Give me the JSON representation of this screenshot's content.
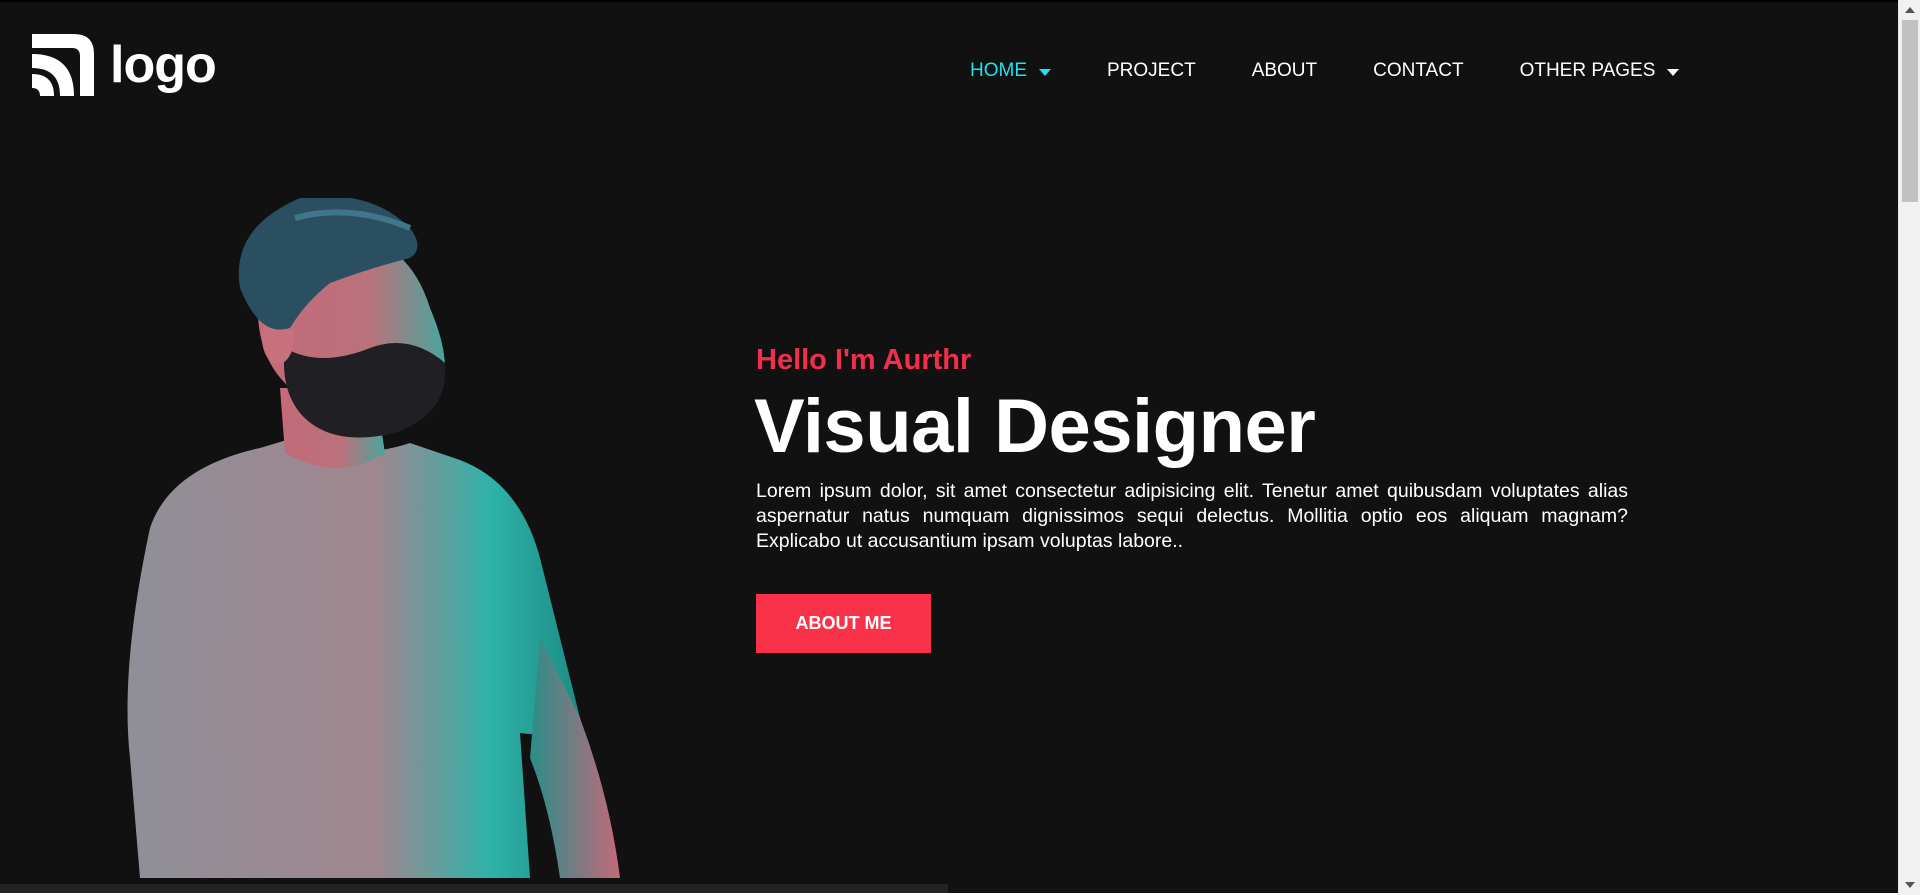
{
  "header": {
    "logo_text": "logo",
    "nav": [
      {
        "label": "HOME",
        "has_dropdown": true,
        "active": true
      },
      {
        "label": "PROJECT",
        "has_dropdown": false,
        "active": false
      },
      {
        "label": "ABOUT",
        "has_dropdown": false,
        "active": false
      },
      {
        "label": "CONTACT",
        "has_dropdown": false,
        "active": false
      },
      {
        "label": "OTHER PAGES",
        "has_dropdown": true,
        "active": false
      }
    ]
  },
  "hero": {
    "greeting": "Hello I'm Aurthr",
    "headline": "Visual Designer",
    "description": "Lorem ipsum dolor, sit amet consectetur adipisicing elit. Tenetur amet quibusdam voluptates alias aspernatur natus numquam dignissimos sequi delectus. Mollitia optio eos aliquam magnam? Explicabo ut accusantium ipsam voluptas labore..",
    "cta_label": "ABOUT ME",
    "figure_icon": "portrait-illustration"
  },
  "colors": {
    "background": "#111111",
    "accent_red": "#fa3249",
    "accent_cyan": "#20e0ee",
    "text": "#ffffff"
  }
}
